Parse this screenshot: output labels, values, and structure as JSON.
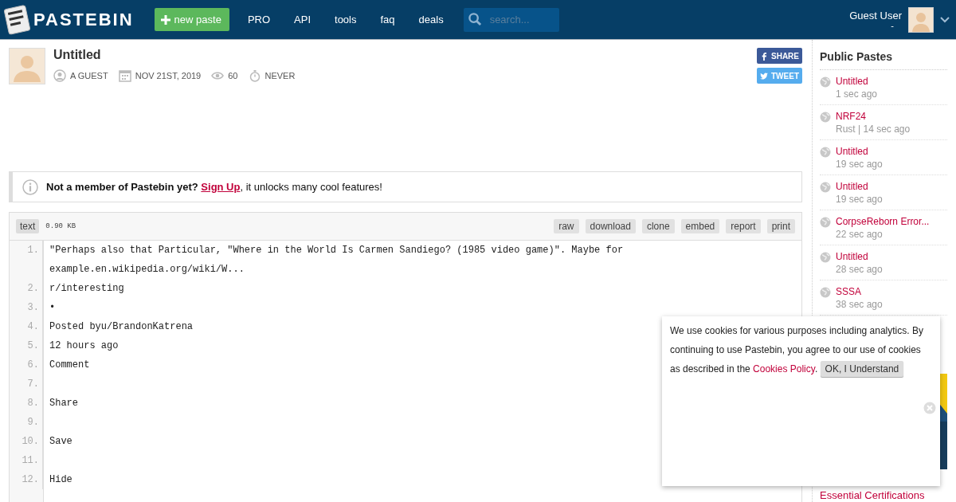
{
  "header": {
    "logo_text": "PASTEBIN",
    "new_paste": "new paste",
    "nav": [
      "PRO",
      "API",
      "tools",
      "faq",
      "deals"
    ],
    "search": {
      "placeholder": "search..."
    },
    "user": {
      "name": "Guest User",
      "sub": "-"
    }
  },
  "paste": {
    "title": "Untitled",
    "meta": [
      {
        "kind": "author",
        "text": "A GUEST"
      },
      {
        "kind": "date",
        "text": "NOV 21ST, 2019"
      },
      {
        "kind": "views",
        "text": "60"
      },
      {
        "kind": "expire",
        "text": "NEVER"
      }
    ],
    "share": [
      {
        "kind": "facebook",
        "label": "SHARE"
      },
      {
        "kind": "twitter",
        "label": "TWEET"
      }
    ]
  },
  "notice": {
    "bold": "Not a member of Pastebin yet?",
    "link": "Sign Up",
    "rest": ", it unlocks many cool features!"
  },
  "code": {
    "format": "text",
    "size": "0.90 KB",
    "actions": [
      "raw",
      "download",
      "clone",
      "embed",
      "report",
      "print"
    ],
    "lines": [
      {
        "number": "1.",
        "text": "\"Perhaps also that Particular, \"Where in the World Is Carmen Sandiego? (1985 video game)\". Maybe for example.en.wikipedia.org/wiki/W..."
      },
      {
        "number": "2.",
        "text": "r/interesting"
      },
      {
        "number": "3.",
        "text": "•"
      },
      {
        "number": "4.",
        "text": "Posted byu/BrandonKatrena"
      },
      {
        "number": "5.",
        "text": "12 hours ago"
      },
      {
        "number": "6.",
        "text": "Comment"
      },
      {
        "number": "7."
      },
      {
        "number": "8.",
        "text": "Share"
      },
      {
        "number": "9."
      },
      {
        "number": "10.",
        "text": "Save"
      },
      {
        "number": "11."
      },
      {
        "number": "12.",
        "text": "Hide"
      }
    ]
  },
  "sidebar": {
    "title": "Public Pastes",
    "pastes": [
      {
        "title": "Untitled",
        "meta": "1 sec ago"
      },
      {
        "title": "NRF24",
        "meta": "Rust | 14 sec ago"
      },
      {
        "title": "Untitled",
        "meta": "19 sec ago"
      },
      {
        "title": "Untitled",
        "meta": "19 sec ago"
      },
      {
        "title": "CorpseReborn Error...",
        "meta": "22 sec ago"
      },
      {
        "title": "Untitled",
        "meta": "28 sec ago"
      },
      {
        "title": "SSSA",
        "meta": "38 sec ago"
      }
    ],
    "ad_caption": "Essential Certifications"
  },
  "cookie": {
    "text": "We use cookies for various purposes including analytics. By continuing to use Pastebin, you agree to our use of cookies as described in the",
    "link": "Cookies Policy",
    "end": ".",
    "button": "OK, I Understand"
  }
}
